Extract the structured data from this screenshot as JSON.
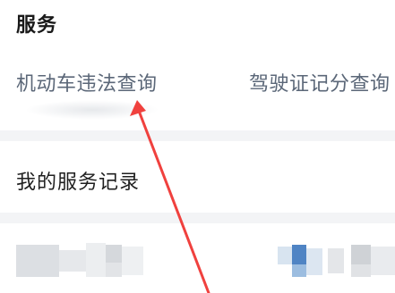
{
  "header": {
    "title": "服务"
  },
  "services": [
    {
      "label": "机动车违法查询"
    },
    {
      "label": "驾驶证记分查询"
    }
  ],
  "records": {
    "label": "我的服务记录"
  },
  "annotation": {
    "arrow_color": "#f0413e"
  },
  "colors": {
    "title_text": "#1a1a1a",
    "service_text": "#5b6778",
    "divider": "#f3f4f6"
  }
}
